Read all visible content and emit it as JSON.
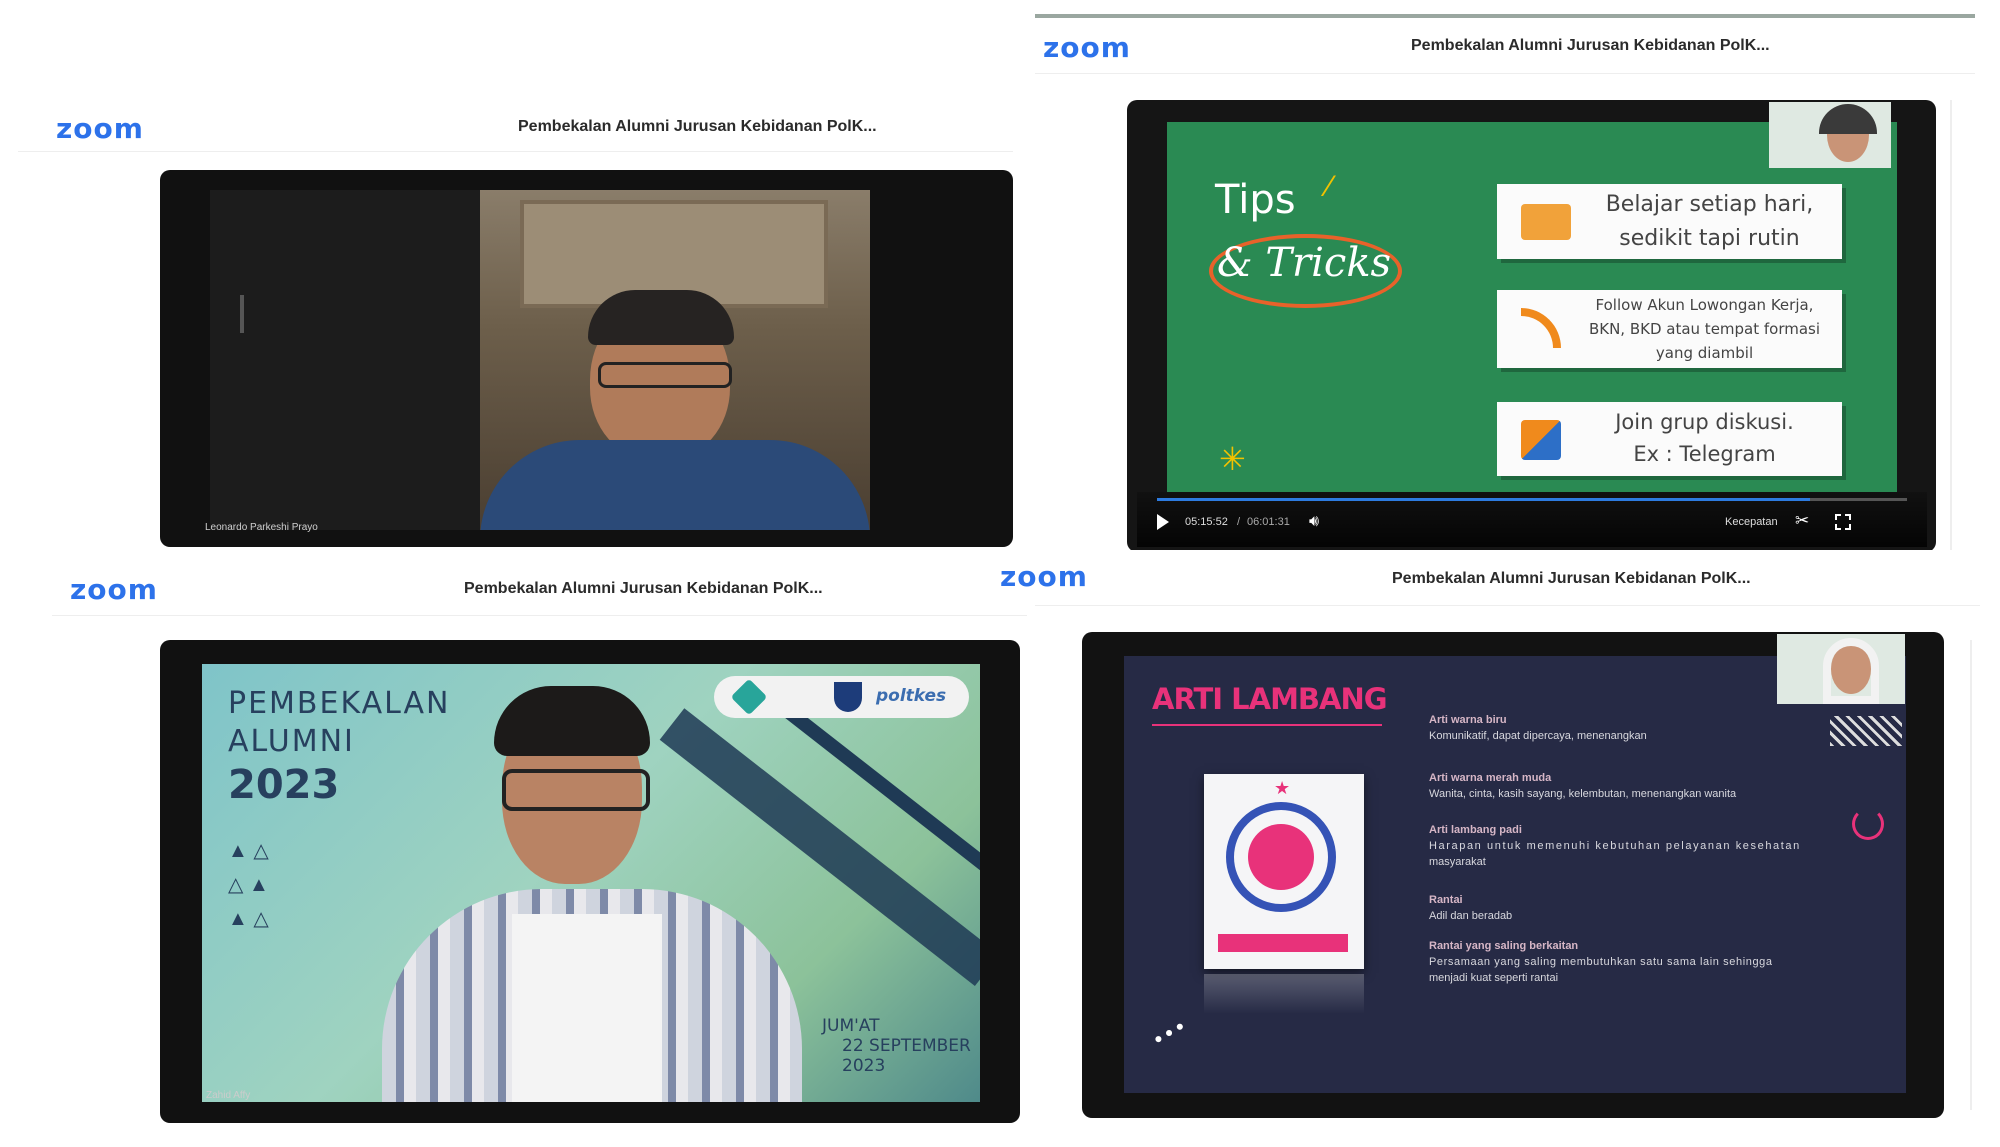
{
  "panels": {
    "top_left": {
      "app_logo": "zoom",
      "meeting_title": "Pembekalan Alumni Jurusan Kebidanan PolK...",
      "participant_name": "Leonardo Parkeshi Prayo"
    },
    "top_right": {
      "app_logo": "zoom",
      "meeting_title": "Pembekalan Alumni Jurusan Kebidanan PolK...",
      "slide": {
        "heading_top": "Tips",
        "heading_bottom": "& Tricks",
        "tips": [
          {
            "line1": "Belajar setiap hari,",
            "line2": "sedikit tapi rutin",
            "line3": ""
          },
          {
            "line1": "Follow Akun Lowongan Kerja,",
            "line2": "BKN, BKD atau tempat formasi",
            "line3": "yang diambil"
          },
          {
            "line1": "Join grup diskusi.",
            "line2": "Ex : Telegram",
            "line3": ""
          }
        ]
      },
      "player": {
        "current_time": "05:15:52",
        "separator": "/",
        "total_time": "06:01:31",
        "speed_label": "Kecepatan",
        "progress": 0.87
      }
    },
    "bottom_left": {
      "app_logo": "zoom",
      "meeting_title": "Pembekalan Alumni Jurusan Kebidanan PolK...",
      "slide": {
        "line1": "PEMBEKALAN",
        "line2": "ALUMNI",
        "year": "2023",
        "day": "JUM'AT",
        "date": "22 SEPTEMBER",
        "date_year": "2023",
        "brand": "poltkes"
      },
      "participant_name": "Zahid Affy"
    },
    "bottom_right": {
      "app_logo": "zoom",
      "meeting_title": "Pembekalan Alumni Jurusan Kebidanan PolK...",
      "slide": {
        "title": "ARTI LAMBANG",
        "items": [
          {
            "heading": "Arti warna biru",
            "desc1": "Komunikatif, dapat dipercaya, menenangkan",
            "desc2": ""
          },
          {
            "heading": "Arti warna merah muda",
            "desc1": "Wanita, cinta, kasih sayang, kelembutan, menenangkan wanita",
            "desc2": ""
          },
          {
            "heading": "Arti lambang padi",
            "desc1": "Harapan untuk memenuhi kebutuhan pelayanan kesehatan",
            "desc2": "masyarakat"
          },
          {
            "heading": "Rantai",
            "desc1": "Adil dan beradab",
            "desc2": ""
          },
          {
            "heading": "Rantai yang saling berkaitan",
            "desc1": "Persamaan yang saling membutuhkan satu sama lain sehingga",
            "desc2": "menjadi kuat seperti rantai"
          }
        ]
      }
    }
  },
  "colors": {
    "zoom_blue": "#2d72ea",
    "chalkboard": "#2a8a53",
    "lambang_bg": "#262a45",
    "lambang_title": "#e8327a",
    "accent_orange": "#e8622a"
  }
}
